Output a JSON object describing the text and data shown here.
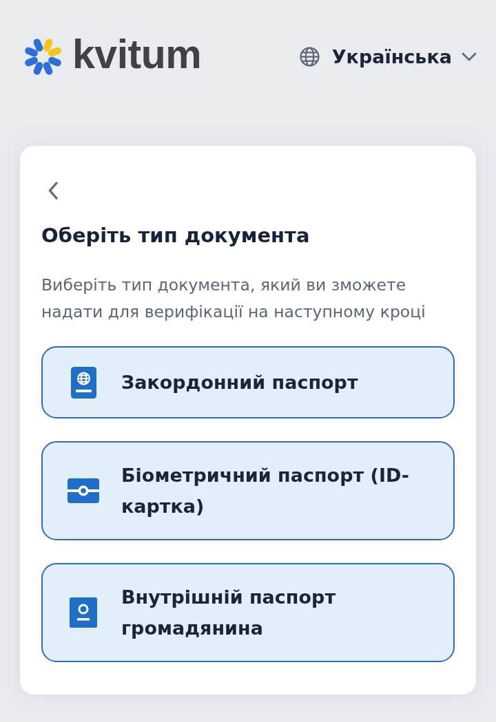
{
  "header": {
    "logo": {
      "text": "kvitum"
    },
    "language": {
      "label": "Українська"
    }
  },
  "card": {
    "title": "Оберіть тип документа",
    "subtitle": "Виберіть тип документа, який ви зможете надати для верифікації на наступному кроці",
    "options": [
      {
        "kind": "passport",
        "label": "Закордонний паспорт"
      },
      {
        "kind": "id-card",
        "label": "Біометричний паспорт (ID-картка)"
      },
      {
        "kind": "internal-passport",
        "label": "Внутрішній паспорт громадянина"
      }
    ]
  }
}
